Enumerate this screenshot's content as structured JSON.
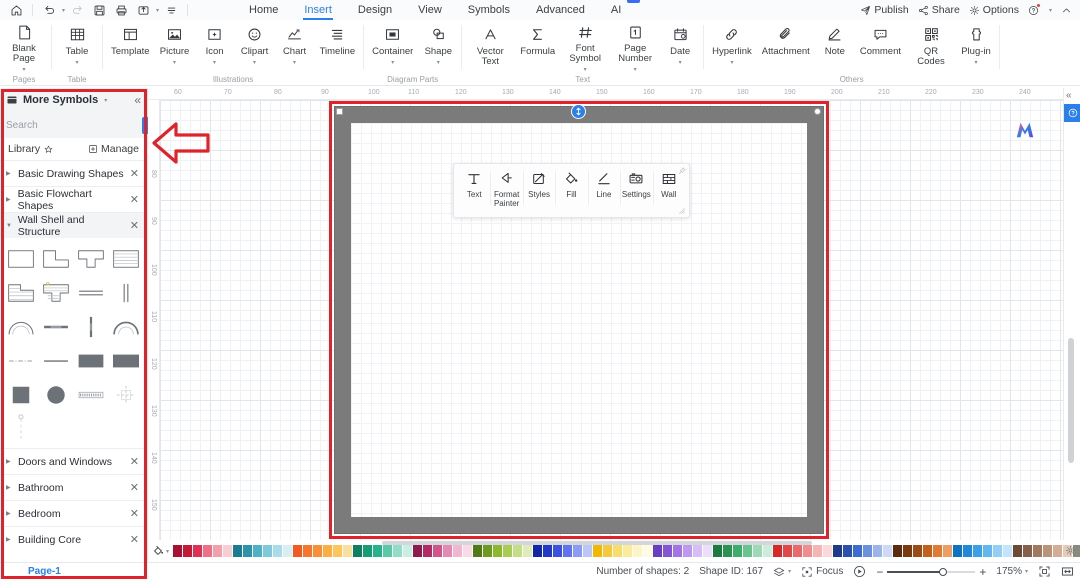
{
  "quick_access": [
    {
      "name": "home-icon",
      "label": "Home"
    },
    {
      "name": "undo-icon",
      "label": "Undo"
    },
    {
      "name": "redo-icon",
      "label": "Redo"
    },
    {
      "name": "save-icon",
      "label": "Save"
    },
    {
      "name": "print-icon",
      "label": "Print"
    },
    {
      "name": "export-icon",
      "label": "Export"
    },
    {
      "name": "customize-icon",
      "label": "Customize Quick Access Toolbar"
    }
  ],
  "menu": {
    "tabs": [
      {
        "label": "Home",
        "active": false
      },
      {
        "label": "Insert",
        "active": true
      },
      {
        "label": "Design",
        "active": false
      },
      {
        "label": "View",
        "active": false
      },
      {
        "label": "Symbols",
        "active": false
      },
      {
        "label": "Advanced",
        "active": false
      },
      {
        "label": "AI",
        "active": false,
        "badge": "hot"
      }
    ],
    "right": [
      {
        "label": "Publish",
        "icon": "publish-icon"
      },
      {
        "label": "Share",
        "icon": "share-icon"
      },
      {
        "label": "Options",
        "icon": "gear-icon"
      },
      {
        "label": "",
        "icon": "help-icon"
      },
      {
        "label": "",
        "icon": "chevron-up-icon"
      }
    ]
  },
  "ribbon": {
    "groups": [
      {
        "name": "Pages",
        "items": [
          {
            "label": "Blank Page",
            "icon": "blank-page-icon",
            "caret": true
          }
        ]
      },
      {
        "name": "Table",
        "items": [
          {
            "label": "Table",
            "icon": "table-icon",
            "caret": true
          }
        ]
      },
      {
        "name": "Illustrations",
        "items": [
          {
            "label": "Template",
            "icon": "template-icon",
            "caret": false
          },
          {
            "label": "Picture",
            "icon": "picture-icon",
            "caret": true
          },
          {
            "label": "Icon",
            "icon": "icon-icon",
            "caret": true
          },
          {
            "label": "Clipart",
            "icon": "clipart-icon",
            "caret": true
          },
          {
            "label": "Chart",
            "icon": "chart-icon",
            "caret": true
          },
          {
            "label": "Timeline",
            "icon": "timeline-icon",
            "caret": false
          }
        ]
      },
      {
        "name": "Diagram Parts",
        "items": [
          {
            "label": "Container",
            "icon": "container-icon",
            "caret": true
          },
          {
            "label": "Shape",
            "icon": "shape-icon",
            "caret": true
          }
        ]
      },
      {
        "name": "Text",
        "items": [
          {
            "label": "Vector Text",
            "icon": "vector-text-icon",
            "caret": false
          },
          {
            "label": "Formula",
            "icon": "formula-icon",
            "caret": false
          },
          {
            "label": "Font Symbol",
            "icon": "font-symbol-icon",
            "caret": true
          },
          {
            "label": "Page Number",
            "icon": "page-number-icon",
            "caret": true
          },
          {
            "label": "Date",
            "icon": "date-icon",
            "caret": true
          }
        ]
      },
      {
        "name": "Others",
        "items": [
          {
            "label": "Hyperlink",
            "icon": "hyperlink-icon",
            "caret": true
          },
          {
            "label": "Attachment",
            "icon": "attachment-icon",
            "caret": false
          },
          {
            "label": "Note",
            "icon": "note-icon",
            "caret": false
          },
          {
            "label": "Comment",
            "icon": "comment-icon",
            "caret": false
          },
          {
            "label": "QR Codes",
            "icon": "qr-code-icon",
            "caret": false
          },
          {
            "label": "Plug-in",
            "icon": "plugin-icon",
            "caret": true
          }
        ]
      }
    ]
  },
  "symbol_panel": {
    "title": "More Symbols",
    "title_caret": "▾",
    "collapse_icon": "chevron-double-left-icon",
    "search": {
      "placeholder": "Search",
      "value": "",
      "button_label": "Search"
    },
    "library_label": "Library",
    "manage_label": "Manage",
    "categories": [
      {
        "label": "Basic Drawing Shapes",
        "open": false
      },
      {
        "label": "Basic Flowchart Shapes",
        "open": false
      },
      {
        "label": "Wall Shell and Structure",
        "open": true
      },
      {
        "label": "Doors and Windows",
        "open": false
      },
      {
        "label": "Bathroom",
        "open": false
      },
      {
        "label": "Bedroom",
        "open": false
      },
      {
        "label": "Building Core",
        "open": false
      }
    ],
    "shapes": [
      "wall-rectangle",
      "wall-l-shape",
      "wall-t-shape",
      "wall-hatched-rect",
      "wall-l-hatched",
      "wall-t-hatched",
      "wall-straight-double",
      "wall-vertical-double",
      "wall-arc-thin",
      "wall-straight-thick",
      "wall-vertical-thin",
      "wall-arc-thick",
      "wall-dashed-center",
      "wall-straight-line",
      "wall-filled-rect-wide",
      "wall-filled-rect-wide2",
      "wall-filled-square",
      "wall-filled-circle",
      "wall-dotted-band",
      "wall-crosshair",
      "wall-column-marker"
    ]
  },
  "rulers": {
    "horizontal_ticks": [
      60,
      70,
      80,
      90,
      100,
      110,
      120,
      130,
      140,
      150,
      160,
      170,
      180,
      190,
      200,
      210,
      220,
      230,
      240
    ],
    "vertical_ticks": [
      80,
      90,
      100,
      110,
      120,
      130,
      140,
      150
    ]
  },
  "mini_toolbar": {
    "items": [
      {
        "label": "Text",
        "icon": "text-icon"
      },
      {
        "label": "Format Painter",
        "icon": "format-painter-icon"
      },
      {
        "label": "Styles",
        "icon": "styles-icon"
      },
      {
        "label": "Fill",
        "icon": "fill-bucket-icon"
      },
      {
        "label": "Line",
        "icon": "line-icon"
      },
      {
        "label": "Settings",
        "icon": "settings-camera-icon"
      },
      {
        "label": "Wall",
        "icon": "wall-icon"
      }
    ],
    "pin_icon": "pin-icon",
    "resize_icon": "resize-handle-icon"
  },
  "right_rail": {
    "collapse_icon": "chevron-double-left-icon",
    "help_icon": "help-circle-icon"
  },
  "canvas": {
    "watermark_logo": "brand-logo",
    "rotate_icon": "rotate-handle-icon"
  },
  "color_strip": {
    "fill_icon": "fill-color-icon",
    "fill_caret": "▾",
    "settings_icon": "gear-icon",
    "swatches": [
      "#a81133",
      "#c41a36",
      "#e03055",
      "#ee6f86",
      "#f3a0ad",
      "#f8cdd4",
      "#1a7b91",
      "#2d93ab",
      "#4fb0c6",
      "#7fc9da",
      "#a9dcea",
      "#d7eef5",
      "#f4591f",
      "#f6762f",
      "#f99038",
      "#fbae44",
      "#fcc65b",
      "#f9dfa0",
      "#0f7f5f",
      "#189c73",
      "#26b389",
      "#5ac9a9",
      "#93dcc7",
      "#c9efe3",
      "#8d1b4f",
      "#b32a66",
      "#d1548b",
      "#e689b2",
      "#f2b7d0",
      "#f9dbe8",
      "#4f7a16",
      "#6d9b20",
      "#8cb82e",
      "#a8cd52",
      "#c3de85",
      "#dfecb9",
      "#1226a8",
      "#2139c6",
      "#3a52e0",
      "#5f74ee",
      "#8c9cf4",
      "#bdc6f9",
      "#f2b705",
      "#f6c83d",
      "#f9dd6b",
      "#fceb9b",
      "#fdf4c7",
      "#fefae3",
      "#6a3ec0",
      "#8555d6",
      "#a274e6",
      "#bd99ef",
      "#d6bdf6",
      "#ecdffb",
      "#1d7a3f",
      "#2a9352",
      "#3cae69",
      "#6ac48f",
      "#9cd9b5",
      "#ceecdb",
      "#d62828",
      "#e34848",
      "#ea6a6a",
      "#f08e8e",
      "#f6b4b4",
      "#fbd9d9",
      "#1e3a8a",
      "#2b50ad",
      "#3c6bd1",
      "#6a90e0",
      "#9bb5ec",
      "#cdd9f6",
      "#5c2a0c",
      "#7a3a10",
      "#9a4b16",
      "#c2601c",
      "#e07a34",
      "#ef9e63",
      "#0b72c4",
      "#2088d8",
      "#3ba0e8",
      "#63b7f0",
      "#93cef6",
      "#c4e4fb",
      "#6b4a38",
      "#86604a",
      "#a1795f",
      "#bb9379",
      "#d2ae97",
      "#e7cbb9",
      "#8a8a7e",
      "#a1a196",
      "#b7b7ad",
      "#cccbc4",
      "#e0dfda",
      "#f2f1ee",
      "#111111",
      "#2b2b2b",
      "#454545",
      "#606060",
      "#7b7b7b",
      "#969696",
      "#b1b1b1",
      "#c8c8c8",
      "#dedede",
      "#efefef",
      "#f7f7f7",
      "#ffffff"
    ]
  },
  "status_bar": {
    "page_tab": "Page-1",
    "page_tab_caret": "▾",
    "page_add": "+",
    "page_layout_icon": "page-layout-icon",
    "shapes_count_label": "Number of shapes: 2",
    "shape_id_label": "Shape ID: 167",
    "layers_icon": "layers-icon",
    "layers_caret": "▾",
    "focus_label": "Focus",
    "focus_icon": "focus-icon",
    "present_icon": "present-play-icon",
    "zoom_minus": "−",
    "zoom_plus": "+",
    "zoom_level": "175%",
    "zoom_caret": "▾",
    "fit_page_icon": "fit-page-icon",
    "fit_width_icon": "fit-width-icon"
  },
  "annotation": {
    "color": "#e0232a",
    "panel_highlight": "left-symbol-panel-highlight",
    "shape_highlight": "selected-wall-shape-highlight",
    "arrow": "left-pointing-arrow"
  }
}
